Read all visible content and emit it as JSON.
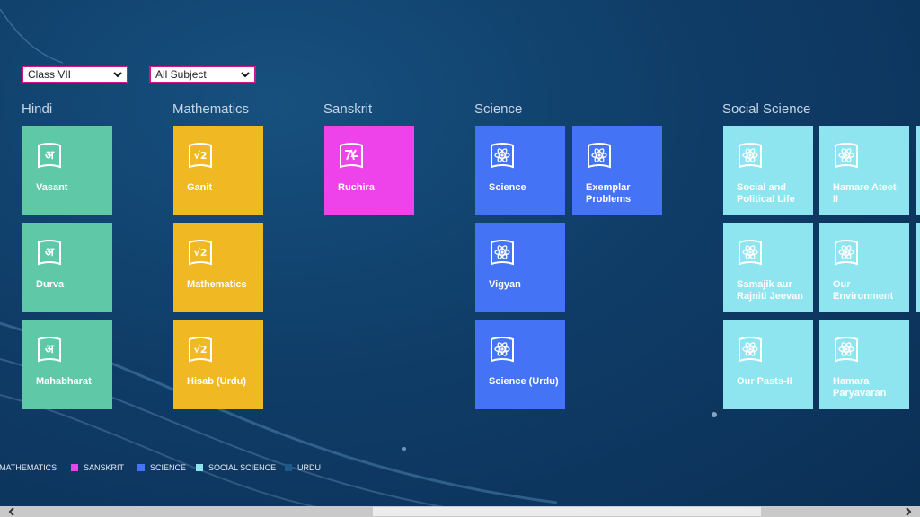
{
  "filters": {
    "class": "Class VII",
    "subject": "All Subject"
  },
  "groups": [
    {
      "title": "Hindi"
    },
    {
      "title": "Mathematics"
    },
    {
      "title": "Sanskrit"
    },
    {
      "title": "Science"
    },
    {
      "title": "Social Science"
    }
  ],
  "tiles": {
    "hindi": [
      "Vasant",
      "Durva",
      "Mahabharat"
    ],
    "maths": [
      "Ganit",
      "Mathematics",
      "Hisab (Urdu)"
    ],
    "sanskrit": [
      "Ruchira"
    ],
    "science": [
      "Science",
      "Exemplar Problems",
      "Vigyan",
      "Science (Urdu)"
    ],
    "social": [
      "Social and Political Life",
      "Hamare Ateet-II",
      "Samajik aur Rajniti Jeevan",
      "Our Environment",
      "Our Pasts-II",
      "Hamara Paryavaran"
    ]
  },
  "legend": [
    {
      "label": "MATHEMATICS",
      "color": "#f0b822"
    },
    {
      "label": "SANSKRIT",
      "color": "#ee43ea"
    },
    {
      "label": "SCIENCE",
      "color": "#4474f5"
    },
    {
      "label": "SOCIAL SCIENCE",
      "color": "#8fe5ef"
    },
    {
      "label": "URDU",
      "color": "#1d5a8a"
    }
  ],
  "colors": {
    "hindi": "#5ec8a7",
    "mathematics": "#f0b822",
    "sanskrit": "#ee43ea",
    "science": "#4474f5",
    "social_science": "#8fe5ef",
    "filter_border": "#d0148f"
  },
  "icons": {
    "hindi": "book-hindi-letter-icon",
    "mathematics": "book-square-root-icon",
    "sanskrit": "book-sanskrit-letter-icon",
    "science": "book-atom-icon",
    "social_science": "book-atom-icon"
  }
}
